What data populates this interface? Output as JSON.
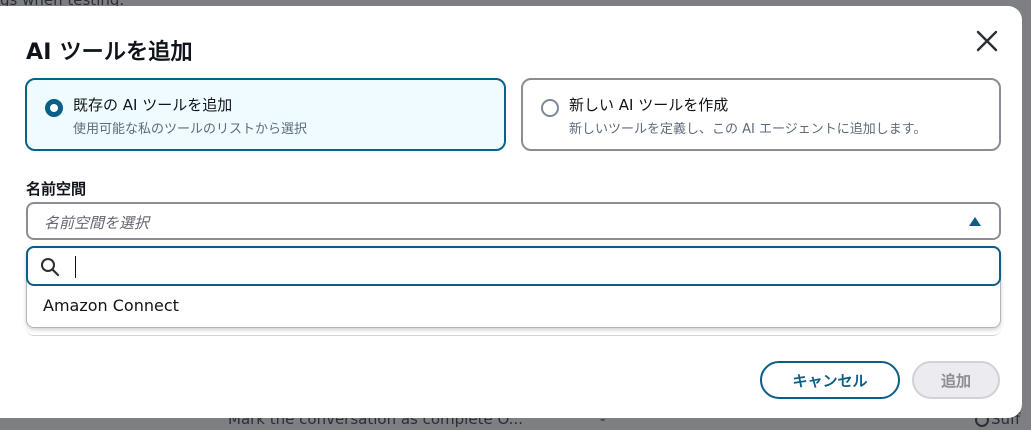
{
  "background": {
    "top_text": "gs when testing.",
    "bottom_text": "Mark the conversation as complete O...",
    "bottom_dash": "-",
    "bottom_right_text": "Suff"
  },
  "modal": {
    "title": "AI ツールを追加",
    "close_icon": "close-icon",
    "options": [
      {
        "label": "既存の AI ツールを追加",
        "description": "使用可能な私のツールのリストから選択",
        "selected": true
      },
      {
        "label": "新しい AI ツールを作成",
        "description": "新しいツールを定義し、この AI エージェントに追加します。",
        "selected": false
      }
    ],
    "namespace": {
      "label": "名前空間",
      "placeholder": "名前空間を選択",
      "filter_value": "",
      "search_icon": "search-icon",
      "items": [
        "Amazon Connect"
      ]
    },
    "buttons": {
      "cancel": "キャンセル",
      "add": "追加"
    }
  },
  "colors": {
    "accent": "#0b5f86",
    "selected_tile_bg": "#f0fbff",
    "disabled_bg": "#ebebf0"
  }
}
